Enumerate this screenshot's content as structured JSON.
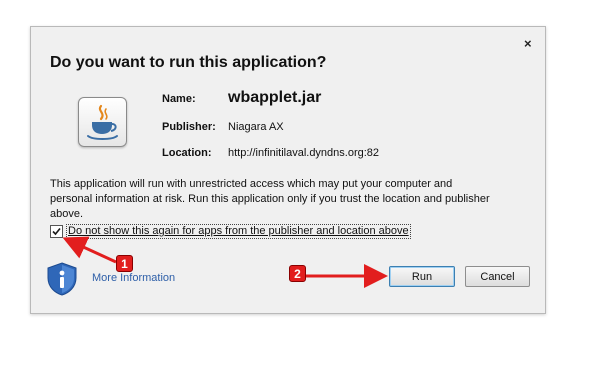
{
  "dialog": {
    "title": "Do you want to run this application?",
    "close_glyph": "×"
  },
  "app": {
    "icon": "java-icon",
    "name_label": "Name:",
    "name_value": "wbapplet.jar",
    "publisher_label": "Publisher:",
    "publisher_value": "Niagara AX",
    "location_label": "Location:",
    "location_value": "http://infinitilaval.dyndns.org:82"
  },
  "warning_text": "This application will run with unrestricted access which may put your computer and personal information at risk. Run this application only if you trust the location and publisher above.",
  "checkbox": {
    "label": "Do not show this again for apps from the publisher and location above",
    "checked": true
  },
  "footer": {
    "shield_icon": "info-shield-icon",
    "more_info_label": "More Information",
    "run_label": "Run",
    "cancel_label": "Cancel"
  },
  "annotations": {
    "badge_1": "1",
    "badge_2": "2",
    "color": "#e21e1e"
  }
}
